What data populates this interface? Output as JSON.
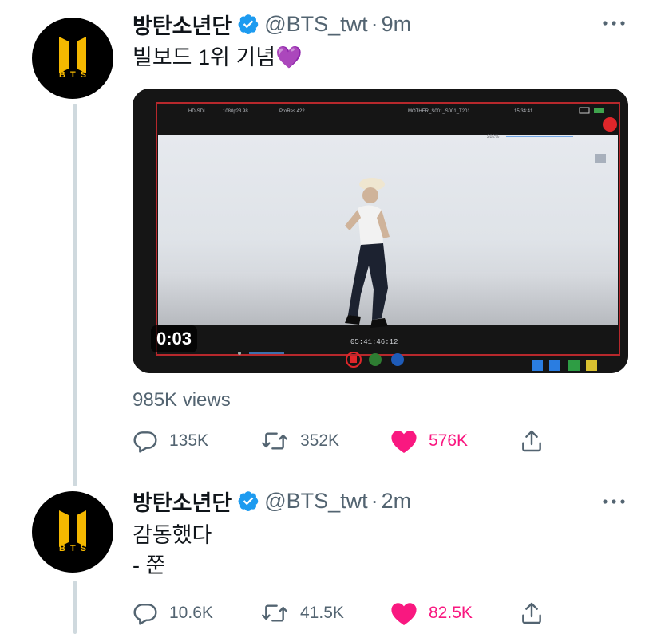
{
  "tweets": [
    {
      "avatar_text": "BTS",
      "name": "방탄소년단",
      "handle": "@BTS_twt",
      "separator": "·",
      "time": "9m",
      "text_lines": [
        "빌보드 1위 기념💜"
      ],
      "video": {
        "duration": "0:03",
        "hud_top": [
          "HD-SDI",
          "1080p23.98",
          "ProRes 422",
          "MOTHER_S001_S001_T201",
          "15:34:41"
        ],
        "zoom": "282%",
        "timecode": "05:41:46:12"
      },
      "views": "985K views",
      "replies": "135K",
      "retweets": "352K",
      "likes": "576K"
    },
    {
      "avatar_text": "BTS",
      "name": "방탄소년단",
      "handle": "@BTS_twt",
      "separator": "·",
      "time": "2m",
      "text_lines": [
        "감동했다",
        "- 쭌"
      ],
      "replies": "10.6K",
      "retweets": "41.5K",
      "likes": "82.5K"
    }
  ],
  "colors": {
    "verified": "#1d9bf0",
    "like": "#f91880",
    "muted": "#536471",
    "thread_line": "#cfd9de",
    "logo": "#f5b800"
  },
  "icons": [
    "verified-badge-icon",
    "more-icon",
    "reply-icon",
    "retweet-icon",
    "heart-icon",
    "share-icon"
  ]
}
